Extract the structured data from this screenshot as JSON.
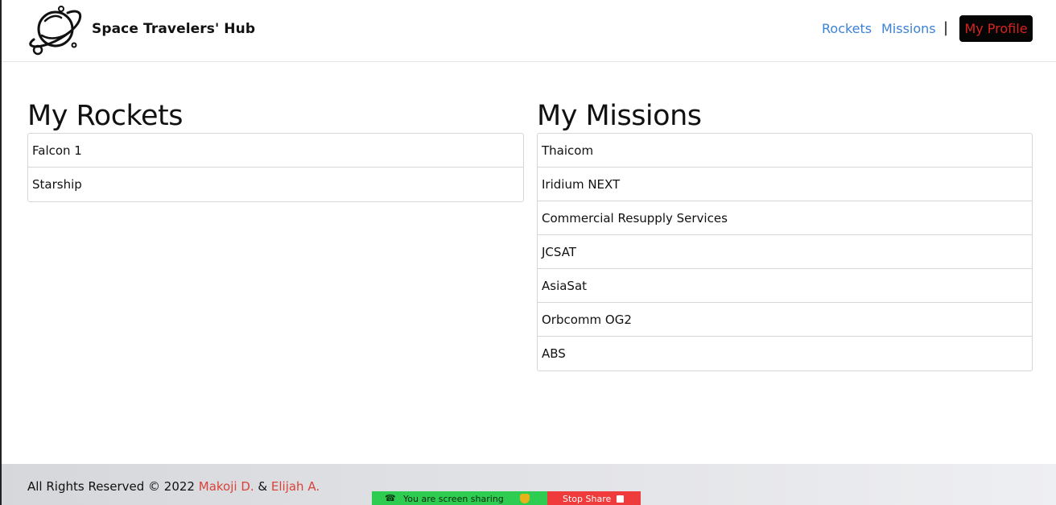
{
  "header": {
    "brand": "Space Travelers' Hub",
    "logo_icon": "planet-logo-icon",
    "nav": {
      "rockets": "Rockets",
      "missions": "Missions",
      "separator": "|",
      "profile": "My Profile"
    }
  },
  "rockets": {
    "title": "My Rockets",
    "items": [
      "Falcon 1",
      "Starship"
    ]
  },
  "missions": {
    "title": "My Missions",
    "items": [
      "Thaicom",
      "Iridium NEXT",
      "Commercial Resupply Services",
      "JCSAT",
      "AsiaSat",
      "Orbcomm OG2",
      "ABS"
    ]
  },
  "footer": {
    "prefix": "All Rights Reserved © 2022 ",
    "author1": "Makoji D.",
    "joiner": " & ",
    "author2": "Elijah A."
  },
  "share_bar": {
    "status": "You are screen sharing",
    "stop": "Stop Share"
  },
  "colors": {
    "nav_link": "#3b82d6",
    "profile_bg": "#050505",
    "profile_text": "#d8241f",
    "footer_link": "#d9433a",
    "share_green": "#2ecc51",
    "share_red": "#ef3b3b"
  }
}
